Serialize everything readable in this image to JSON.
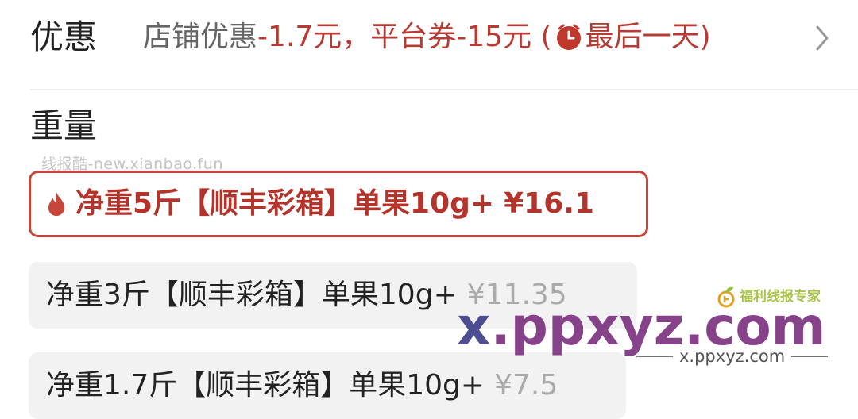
{
  "discount": {
    "heading": "优惠",
    "shop_text": "店铺优惠",
    "shop_amount": "-1.7元，",
    "platform_text": "平台券-15元 (",
    "last_day": "最后一天)"
  },
  "weight": {
    "heading": "重量",
    "source_watermark": "线报酷-new.xianbao.fun",
    "options": [
      {
        "label": "净重5斤【顺丰彩箱】单果10g+",
        "price": "¥16.1",
        "selected": true
      },
      {
        "label": "净重3斤【顺丰彩箱】单果10g+",
        "price": "¥11.35",
        "selected": false
      },
      {
        "label": "净重1.7斤【顺丰彩箱】单果10g+",
        "price": "¥7.5",
        "selected": false
      }
    ]
  },
  "site_watermark": {
    "tagline": "福利线报专家",
    "domain_x": "x",
    "domain_rest": ".ppxyz.com",
    "domain_small": "x.ppxyz.com"
  },
  "colors": {
    "accent_red": "#b4342b",
    "text_dark": "#222222",
    "text_grey": "#666666",
    "price_grey": "#aaaaaa",
    "option_bg": "#f2f2f2"
  },
  "icons": [
    "clock-icon",
    "chevron-right-icon",
    "fire-icon",
    "leaf-icon"
  ]
}
